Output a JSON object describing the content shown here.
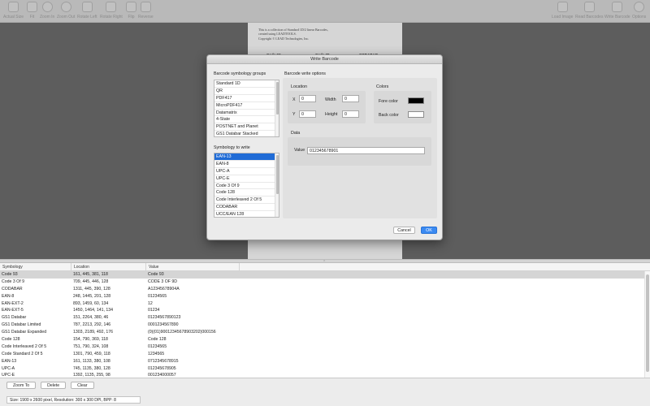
{
  "toolbar": {
    "left": [
      "Actual Size",
      "Fit",
      "Zoom In",
      "Zoom Out",
      "Rotate Left",
      "Rotate Right",
      "Flip",
      "Reverse"
    ],
    "right": [
      "Load Image",
      "Read Barcodes",
      "Write Barcode",
      "Options"
    ]
  },
  "document": {
    "line1": "This is a collection of Standard 1D/2 linear Barcodes,",
    "line2": "created using LEADTOOLS.",
    "line3": "Copyright © LEAD Technologies, Inc.",
    "head1": "Code 93",
    "head2": "Code 39",
    "head3": "CODABAR"
  },
  "dialog": {
    "title": "Write Barcode",
    "groups_label": "Barcode symbology groups",
    "groups": [
      "Standard 1D",
      "QR",
      "PDF417",
      "MicroPDF417",
      "Datamatrix",
      "4-State",
      "POSTNET and Planet",
      "GS1 Databar Stacked"
    ],
    "symbology_label": "Symbology to write",
    "symbologies": [
      "EAN-13",
      "EAN-8",
      "UPC-A",
      "UPC-E",
      "Code 3 Of 9",
      "Code 128",
      "Code Interleaved 2 Of 5",
      "CODABAR",
      "UCC/EAN 128"
    ],
    "options_label": "Barcode write options",
    "location_label": "Location",
    "x_label": "X",
    "x_value": "0",
    "y_label": "Y",
    "y_value": "0",
    "width_label": "Width",
    "width_value": "0",
    "height_label": "Height",
    "height_value": "0",
    "colors_label": "Colors",
    "fore_label": "Fore color",
    "back_label": "Back color",
    "fore_color": "#000000",
    "back_color": "#ffffff",
    "data_label": "Data",
    "value_label": "Value",
    "value": "012345678901",
    "cancel": "Cancel",
    "ok": "OK"
  },
  "table": {
    "headers": [
      "Symbology",
      "Location",
      "Value"
    ],
    "rows": [
      [
        "Code 93",
        "161, 445, 381, 118",
        "Code 93"
      ],
      [
        "Code 3 Of 9",
        "709, 445, 446, 128",
        "CODE 3 OF 9D"
      ],
      [
        "CODABAR",
        "1311, 445, 390, 128",
        "A12345678904A"
      ],
      [
        "EAN-8",
        "248, 1445, 201, 128",
        "01234565"
      ],
      [
        "EAN-EXT-2",
        "893, 1459, 60, 134",
        "12"
      ],
      [
        "EAN-EXT-5",
        "1450, 1464, 141, 134",
        "01234"
      ],
      [
        "GS1 Databar",
        "151, 2264, 380, 46",
        "01234567890123"
      ],
      [
        "GS1 Databar Limited",
        "787, 2213, 292, 146",
        "0001234567890"
      ],
      [
        "GS1 Databar Expanded",
        "1303, 2189, 492, 176",
        "(0)(01)90012345678903202)000156"
      ],
      [
        "Code 128",
        "154, 790, 369, 118",
        "Code 128"
      ],
      [
        "Code Interleaved 2 Of 5",
        "751, 790, 324, 108",
        "01234565"
      ],
      [
        "Code Standard 2 Of 5",
        "1301, 790, 459, 118",
        "1234565"
      ],
      [
        "EAN-13",
        "161, 1133, 380, 108",
        "0712345678915"
      ],
      [
        "UPC-A",
        "745, 1135, 380, 128",
        "012345678905"
      ],
      [
        "UPC-E",
        "1392, 1135, 255, 98",
        "001234000057"
      ]
    ]
  },
  "buttons": {
    "zoom": "Zoom To",
    "delete": "Delete",
    "clear": "Clear"
  },
  "status": "Size: 1900 x 2600 pixel, Resolution: 300 x 300 DPI, BPP: 8"
}
